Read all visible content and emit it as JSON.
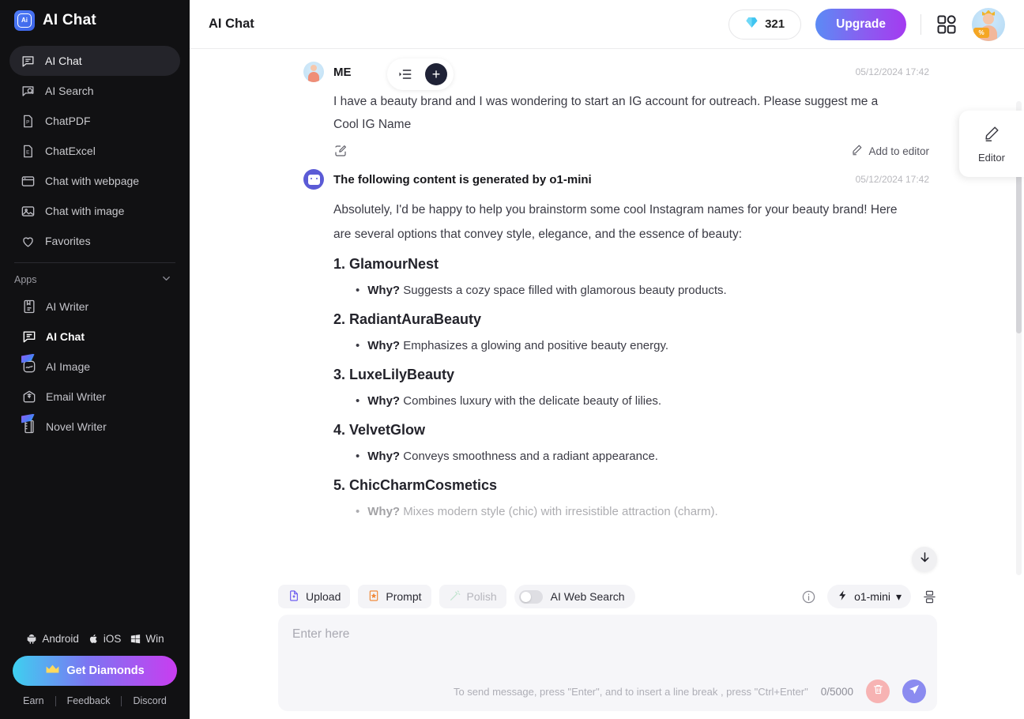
{
  "sidebar": {
    "brand": {
      "name": "AI Chat",
      "logo_icon": "ai-logo-icon"
    },
    "nav": [
      {
        "label": "AI Chat",
        "icon": "chat-bubble-icon",
        "active": true
      },
      {
        "label": "AI Search",
        "icon": "search-doc-icon",
        "active": false
      },
      {
        "label": "ChatPDF",
        "icon": "pdf-file-icon",
        "active": false
      },
      {
        "label": "ChatExcel",
        "icon": "excel-file-icon",
        "active": false
      },
      {
        "label": "Chat with webpage",
        "icon": "browser-window-icon",
        "active": false
      },
      {
        "label": "Chat with image",
        "icon": "image-icon",
        "active": false
      },
      {
        "label": "Favorites",
        "icon": "heart-icon",
        "active": false
      }
    ],
    "apps_section": {
      "title": "Apps",
      "chevron_icon": "chevron-down-icon"
    },
    "apps": [
      {
        "label": "AI Writer",
        "icon": "writer-book-icon",
        "badge": false,
        "selected": false
      },
      {
        "label": "AI Chat",
        "icon": "chat-bubble-icon",
        "badge": false,
        "selected": true
      },
      {
        "label": "AI Image",
        "icon": "image-frame-icon",
        "badge": true,
        "selected": false
      },
      {
        "label": "Email Writer",
        "icon": "email-icon",
        "badge": false,
        "selected": false
      },
      {
        "label": "Novel Writer",
        "icon": "notebook-icon",
        "badge": true,
        "selected": false
      }
    ],
    "platforms": [
      {
        "label": "Android",
        "icon": "android-icon"
      },
      {
        "label": "iOS",
        "icon": "apple-icon"
      },
      {
        "label": "Win",
        "icon": "windows-icon"
      }
    ],
    "diamond_button": {
      "label": "Get Diamonds",
      "icon": "crown-icon"
    },
    "footer_links": [
      "Earn",
      "Feedback",
      "Discord"
    ]
  },
  "topbar": {
    "title": "AI Chat",
    "credits": {
      "value": "321",
      "icon": "diamond-icon"
    },
    "upgrade_label": "Upgrade",
    "grid_icon": "apps-grid-icon",
    "avatar_icon": "user-avatar"
  },
  "chat_tools": {
    "list_icon": "conversation-list-icon",
    "new_chat_icon": "plus-icon"
  },
  "conversation": {
    "user_message": {
      "author": "ME",
      "time": "05/12/2024 17:42",
      "text": "I have a beauty brand and I was wondering to start an IG account for outreach. Please suggest me a Cool IG Name",
      "edit_icon": "edit-square-icon",
      "add_to_editor": {
        "label": "Add to editor",
        "icon": "pencil-icon"
      }
    },
    "ai_message": {
      "author": "The following content is generated by o1-mini",
      "time": "05/12/2024 17:42",
      "intro": "Absolutely, I'd be happy to help you brainstorm some cool Instagram names for your beauty brand! Here are several options that convey style, elegance, and the essence of beauty:",
      "items": [
        {
          "heading": "1. GlamourNest",
          "why_label": "Why?",
          "why_text": "Suggests a cozy space filled with glamorous beauty products."
        },
        {
          "heading": "2. RadiantAuraBeauty",
          "why_label": "Why?",
          "why_text": "Emphasizes a glowing and positive beauty energy."
        },
        {
          "heading": "3. LuxeLilyBeauty",
          "why_label": "Why?",
          "why_text": "Combines luxury with the delicate beauty of lilies."
        },
        {
          "heading": "4. VelvetGlow",
          "why_label": "Why?",
          "why_text": "Conveys smoothness and a radiant appearance."
        },
        {
          "heading": "5. ChicCharmCosmetics",
          "why_label": "Why?",
          "why_text": "Mixes modern style (chic) with irresistible attraction (charm)."
        }
      ]
    },
    "scroll_down_icon": "arrow-down-icon"
  },
  "editor_dock": {
    "label": "Editor",
    "icon": "pencil-icon"
  },
  "composer": {
    "tools": [
      {
        "label": "Upload",
        "icon": "upload-file-icon",
        "disabled": false
      },
      {
        "label": "Prompt",
        "icon": "prompt-card-icon",
        "disabled": false
      },
      {
        "label": "Polish",
        "icon": "polish-wand-icon",
        "disabled": true
      }
    ],
    "web_search": {
      "label": "AI Web Search",
      "enabled": false
    },
    "info_icon": "info-icon",
    "model": {
      "label": "o1-mini",
      "icon": "spark-icon",
      "chevron": "▾"
    },
    "compare_icon": "split-view-icon",
    "input_placeholder": "Enter here",
    "hint": "To send message, press \"Enter\", and to insert a line break , press \"Ctrl+Enter\"",
    "counter": "0/5000",
    "delete_icon": "trash-icon",
    "send_icon": "send-icon"
  },
  "colors": {
    "sidebar_bg": "#111113",
    "accent_purple": "#8b5cf0",
    "accent_blue": "#5b8bf5",
    "diamond_gradient_start": "#3ed0f0",
    "diamond_gradient_end": "#c93df0"
  }
}
